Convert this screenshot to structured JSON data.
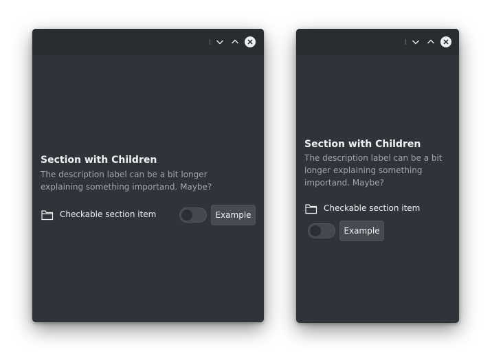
{
  "windows": [
    {
      "titlebar": {
        "icons": [
          "chevron-down-icon",
          "chevron-up-icon",
          "close-icon"
        ]
      },
      "section": {
        "title": "Section with Children",
        "desc_lines": [
          "The description label can be a bit longer",
          "explaining something importand. Maybe?"
        ]
      },
      "item": {
        "icon": "folder-icon",
        "label": "Checkable section item",
        "toggle_checked": false,
        "button_label": "Example"
      }
    },
    {
      "titlebar": {
        "icons": [
          "chevron-down-icon",
          "chevron-up-icon",
          "close-icon"
        ]
      },
      "section": {
        "title": "Section with Children",
        "desc_lines": [
          "The description label can be a bit",
          "longer explaining something",
          "importand. Maybe?"
        ]
      },
      "item": {
        "icon": "folder-icon",
        "label": "Checkable section item",
        "toggle_checked": false,
        "button_label": "Example"
      }
    }
  ],
  "colors": {
    "window_bg": "#30343a",
    "titlebar_bg": "#292c31",
    "text": "#eff0f1",
    "muted_text": "#a2a6ab"
  }
}
